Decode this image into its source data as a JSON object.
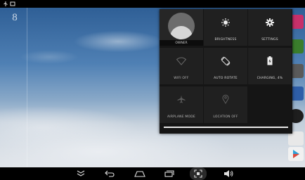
{
  "status_bar": {
    "left_icons": [
      "usb-icon",
      "screenshot-icon"
    ]
  },
  "home": {
    "search_icon": "google-search-icon",
    "right_dock_apps": [
      "app-icon",
      "app-icon",
      "app-icon",
      "app-icon",
      "app-icon",
      "play-store-icon"
    ]
  },
  "quick_settings": {
    "owner": {
      "label": "OWNER",
      "icon": "user-avatar"
    },
    "tiles": [
      {
        "id": "brightness",
        "label": "BRIGHTNESS",
        "icon": "brightness-icon",
        "enabled": true
      },
      {
        "id": "settings",
        "label": "SETTINGS",
        "icon": "gear-icon",
        "enabled": true
      },
      {
        "id": "wifi",
        "label": "WIFI OFF",
        "icon": "wifi-icon",
        "enabled": false
      },
      {
        "id": "auto_rotate",
        "label": "AUTO ROTATE",
        "icon": "rotate-icon",
        "enabled": true
      },
      {
        "id": "battery",
        "label": "CHARGING, 4%",
        "icon": "battery-icon",
        "enabled": true
      },
      {
        "id": "airplane",
        "label": "AIRPLANE MODE",
        "icon": "airplane-icon",
        "enabled": false
      },
      {
        "id": "location",
        "label": "LOCATION OFF",
        "icon": "location-icon",
        "enabled": false
      }
    ],
    "brightness_level": 1.0
  },
  "nav_bar": {
    "buttons": [
      "collapse-icon",
      "back-icon",
      "home-icon",
      "recents-icon",
      "screenshot-icon",
      "volume-icon"
    ]
  },
  "colors": {
    "panel": "#151515",
    "tile": "#202020",
    "label": "#d8d8d8"
  }
}
